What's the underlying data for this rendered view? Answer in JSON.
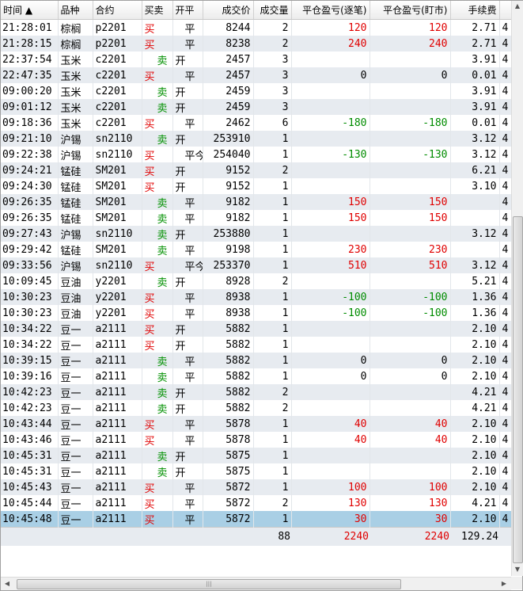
{
  "columns": [
    {
      "key": "time",
      "label": "时间 ▲"
    },
    {
      "key": "name",
      "label": "品种"
    },
    {
      "key": "contract",
      "label": "合约"
    },
    {
      "key": "side",
      "label": "买卖"
    },
    {
      "key": "oc",
      "label": "开平"
    },
    {
      "key": "price",
      "label": "成交价"
    },
    {
      "key": "qty",
      "label": "成交量"
    },
    {
      "key": "pnl_trade",
      "label": "平仓盈亏(逐笔)"
    },
    {
      "key": "pnl_mark",
      "label": "平仓盈亏(盯市)"
    },
    {
      "key": "fee",
      "label": "手续费"
    },
    {
      "key": "extra",
      "label": ""
    }
  ],
  "rows": [
    {
      "time": "21:28:01",
      "name": "棕榈",
      "contract": "p2201",
      "side": "买",
      "oc": "平",
      "price": "8244",
      "qty": "2",
      "pnl_trade": "120",
      "pnl_mark": "120",
      "fee": "2.71",
      "extra": "4"
    },
    {
      "time": "21:28:15",
      "name": "棕榈",
      "contract": "p2201",
      "side": "买",
      "oc": "平",
      "price": "8238",
      "qty": "2",
      "pnl_trade": "240",
      "pnl_mark": "240",
      "fee": "2.71",
      "extra": "4"
    },
    {
      "time": "22:37:54",
      "name": "玉米",
      "contract": "c2201",
      "side": "卖",
      "oc": "开",
      "price": "2457",
      "qty": "3",
      "pnl_trade": "",
      "pnl_mark": "",
      "fee": "3.91",
      "extra": "4"
    },
    {
      "time": "22:47:35",
      "name": "玉米",
      "contract": "c2201",
      "side": "买",
      "oc": "平",
      "price": "2457",
      "qty": "3",
      "pnl_trade": "0",
      "pnl_mark": "0",
      "fee": "0.01",
      "extra": "4"
    },
    {
      "time": "09:00:20",
      "name": "玉米",
      "contract": "c2201",
      "side": "卖",
      "oc": "开",
      "price": "2459",
      "qty": "3",
      "pnl_trade": "",
      "pnl_mark": "",
      "fee": "3.91",
      "extra": "4"
    },
    {
      "time": "09:01:12",
      "name": "玉米",
      "contract": "c2201",
      "side": "卖",
      "oc": "开",
      "price": "2459",
      "qty": "3",
      "pnl_trade": "",
      "pnl_mark": "",
      "fee": "3.91",
      "extra": "4"
    },
    {
      "time": "09:18:36",
      "name": "玉米",
      "contract": "c2201",
      "side": "买",
      "oc": "平",
      "price": "2462",
      "qty": "6",
      "pnl_trade": "-180",
      "pnl_mark": "-180",
      "fee": "0.01",
      "extra": "4"
    },
    {
      "time": "09:21:10",
      "name": "沪锡",
      "contract": "sn2110",
      "side": "卖",
      "oc": "开",
      "price": "253910",
      "qty": "1",
      "pnl_trade": "",
      "pnl_mark": "",
      "fee": "3.12",
      "extra": "4"
    },
    {
      "time": "09:22:38",
      "name": "沪锡",
      "contract": "sn2110",
      "side": "买",
      "oc": "平今",
      "price": "254040",
      "qty": "1",
      "pnl_trade": "-130",
      "pnl_mark": "-130",
      "fee": "3.12",
      "extra": "4"
    },
    {
      "time": "09:24:21",
      "name": "锰硅",
      "contract": "SM201",
      "side": "买",
      "oc": "开",
      "price": "9152",
      "qty": "2",
      "pnl_trade": "",
      "pnl_mark": "",
      "fee": "6.21",
      "extra": "4"
    },
    {
      "time": "09:24:30",
      "name": "锰硅",
      "contract": "SM201",
      "side": "买",
      "oc": "开",
      "price": "9152",
      "qty": "1",
      "pnl_trade": "",
      "pnl_mark": "",
      "fee": "3.10",
      "extra": "4"
    },
    {
      "time": "09:26:35",
      "name": "锰硅",
      "contract": "SM201",
      "side": "卖",
      "oc": "平",
      "price": "9182",
      "qty": "1",
      "pnl_trade": "150",
      "pnl_mark": "150",
      "fee": "",
      "extra": "4"
    },
    {
      "time": "09:26:35",
      "name": "锰硅",
      "contract": "SM201",
      "side": "卖",
      "oc": "平",
      "price": "9182",
      "qty": "1",
      "pnl_trade": "150",
      "pnl_mark": "150",
      "fee": "",
      "extra": "4"
    },
    {
      "time": "09:27:43",
      "name": "沪锡",
      "contract": "sn2110",
      "side": "卖",
      "oc": "开",
      "price": "253880",
      "qty": "1",
      "pnl_trade": "",
      "pnl_mark": "",
      "fee": "3.12",
      "extra": "4"
    },
    {
      "time": "09:29:42",
      "name": "锰硅",
      "contract": "SM201",
      "side": "卖",
      "oc": "平",
      "price": "9198",
      "qty": "1",
      "pnl_trade": "230",
      "pnl_mark": "230",
      "fee": "",
      "extra": "4"
    },
    {
      "time": "09:33:56",
      "name": "沪锡",
      "contract": "sn2110",
      "side": "买",
      "oc": "平今",
      "price": "253370",
      "qty": "1",
      "pnl_trade": "510",
      "pnl_mark": "510",
      "fee": "3.12",
      "extra": "4"
    },
    {
      "time": "10:09:45",
      "name": "豆油",
      "contract": "y2201",
      "side": "卖",
      "oc": "开",
      "price": "8928",
      "qty": "2",
      "pnl_trade": "",
      "pnl_mark": "",
      "fee": "5.21",
      "extra": "4"
    },
    {
      "time": "10:30:23",
      "name": "豆油",
      "contract": "y2201",
      "side": "买",
      "oc": "平",
      "price": "8938",
      "qty": "1",
      "pnl_trade": "-100",
      "pnl_mark": "-100",
      "fee": "1.36",
      "extra": "4"
    },
    {
      "time": "10:30:23",
      "name": "豆油",
      "contract": "y2201",
      "side": "买",
      "oc": "平",
      "price": "8938",
      "qty": "1",
      "pnl_trade": "-100",
      "pnl_mark": "-100",
      "fee": "1.36",
      "extra": "4"
    },
    {
      "time": "10:34:22",
      "name": "豆一",
      "contract": "a2111",
      "side": "买",
      "oc": "开",
      "price": "5882",
      "qty": "1",
      "pnl_trade": "",
      "pnl_mark": "",
      "fee": "2.10",
      "extra": "4"
    },
    {
      "time": "10:34:22",
      "name": "豆一",
      "contract": "a2111",
      "side": "买",
      "oc": "开",
      "price": "5882",
      "qty": "1",
      "pnl_trade": "",
      "pnl_mark": "",
      "fee": "2.10",
      "extra": "4"
    },
    {
      "time": "10:39:15",
      "name": "豆一",
      "contract": "a2111",
      "side": "卖",
      "oc": "平",
      "price": "5882",
      "qty": "1",
      "pnl_trade": "0",
      "pnl_mark": "0",
      "fee": "2.10",
      "extra": "4"
    },
    {
      "time": "10:39:16",
      "name": "豆一",
      "contract": "a2111",
      "side": "卖",
      "oc": "平",
      "price": "5882",
      "qty": "1",
      "pnl_trade": "0",
      "pnl_mark": "0",
      "fee": "2.10",
      "extra": "4"
    },
    {
      "time": "10:42:23",
      "name": "豆一",
      "contract": "a2111",
      "side": "卖",
      "oc": "开",
      "price": "5882",
      "qty": "2",
      "pnl_trade": "",
      "pnl_mark": "",
      "fee": "4.21",
      "extra": "4"
    },
    {
      "time": "10:42:23",
      "name": "豆一",
      "contract": "a2111",
      "side": "卖",
      "oc": "开",
      "price": "5882",
      "qty": "2",
      "pnl_trade": "",
      "pnl_mark": "",
      "fee": "4.21",
      "extra": "4"
    },
    {
      "time": "10:43:44",
      "name": "豆一",
      "contract": "a2111",
      "side": "买",
      "oc": "平",
      "price": "5878",
      "qty": "1",
      "pnl_trade": "40",
      "pnl_mark": "40",
      "fee": "2.10",
      "extra": "4"
    },
    {
      "time": "10:43:46",
      "name": "豆一",
      "contract": "a2111",
      "side": "买",
      "oc": "平",
      "price": "5878",
      "qty": "1",
      "pnl_trade": "40",
      "pnl_mark": "40",
      "fee": "2.10",
      "extra": "4"
    },
    {
      "time": "10:45:31",
      "name": "豆一",
      "contract": "a2111",
      "side": "卖",
      "oc": "开",
      "price": "5875",
      "qty": "1",
      "pnl_trade": "",
      "pnl_mark": "",
      "fee": "2.10",
      "extra": "4"
    },
    {
      "time": "10:45:31",
      "name": "豆一",
      "contract": "a2111",
      "side": "卖",
      "oc": "开",
      "price": "5875",
      "qty": "1",
      "pnl_trade": "",
      "pnl_mark": "",
      "fee": "2.10",
      "extra": "4"
    },
    {
      "time": "10:45:43",
      "name": "豆一",
      "contract": "a2111",
      "side": "买",
      "oc": "平",
      "price": "5872",
      "qty": "1",
      "pnl_trade": "100",
      "pnl_mark": "100",
      "fee": "2.10",
      "extra": "4"
    },
    {
      "time": "10:45:44",
      "name": "豆一",
      "contract": "a2111",
      "side": "买",
      "oc": "平",
      "price": "5872",
      "qty": "2",
      "pnl_trade": "130",
      "pnl_mark": "130",
      "fee": "4.21",
      "extra": "4"
    },
    {
      "time": "10:45:48",
      "name": "豆一",
      "contract": "a2111",
      "side": "买",
      "oc": "平",
      "price": "5872",
      "qty": "1",
      "pnl_trade": "30",
      "pnl_mark": "30",
      "fee": "2.10",
      "extra": "4",
      "selected": true
    }
  ],
  "totals": {
    "qty": "88",
    "pnl_trade": "2240",
    "pnl_mark": "2240",
    "fee": "129.24"
  },
  "colors": {
    "buy": "#e00000",
    "sell": "#009000",
    "profit": "#e00000",
    "loss": "#008c00",
    "selected_row": "#a9cfe5",
    "alt_row": "#e7ebf0"
  },
  "scrollbars": {
    "vertical": {
      "up_icon": "▲",
      "down_icon": "▼"
    },
    "horizontal": {
      "left_icon": "◀",
      "right_icon": "▶",
      "grip": "|||"
    }
  }
}
